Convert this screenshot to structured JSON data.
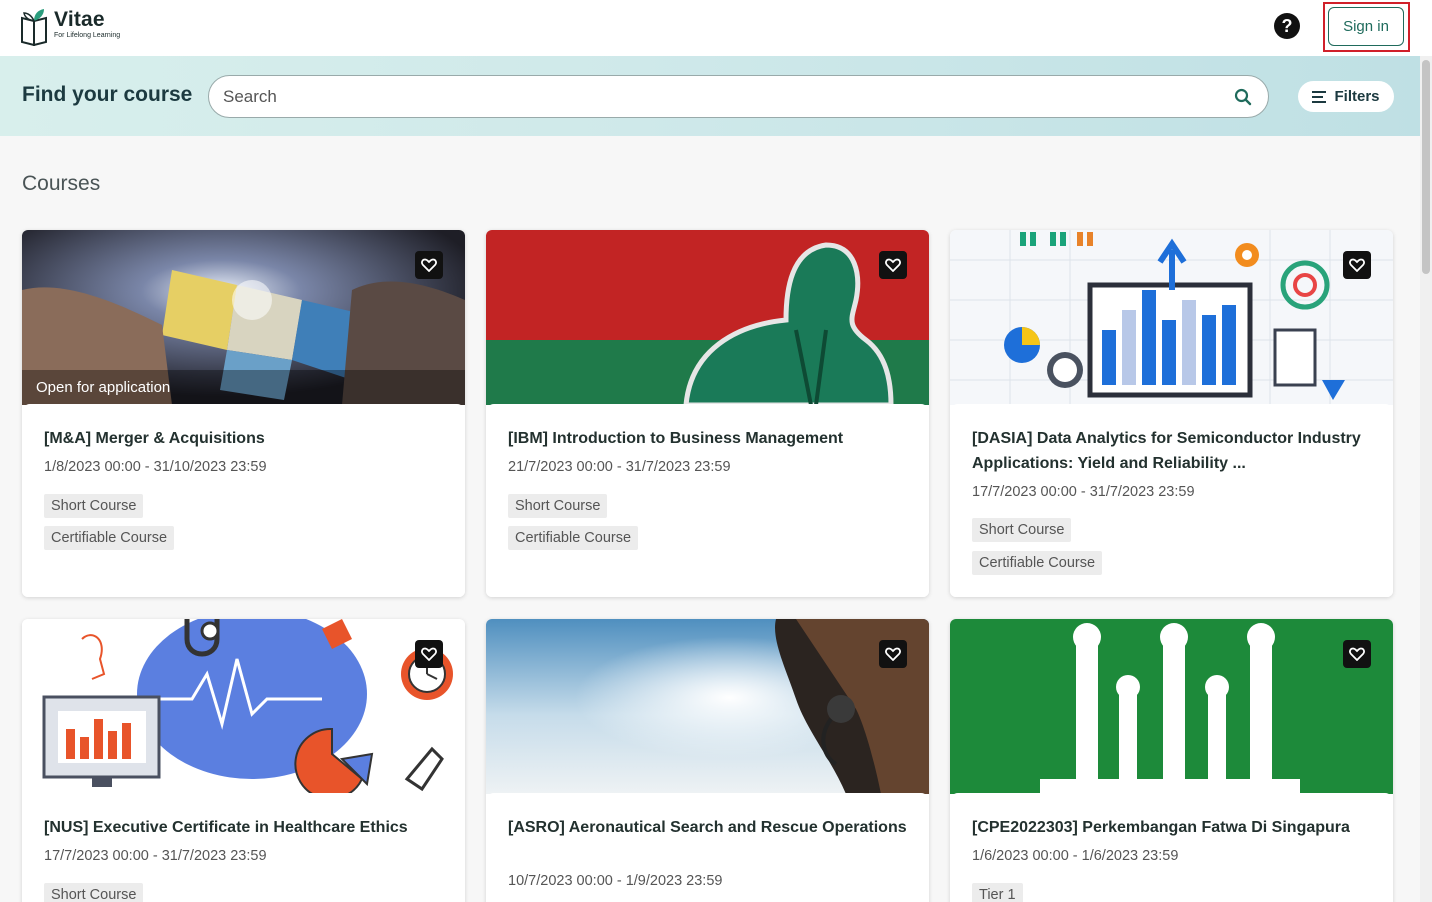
{
  "header": {
    "logo_name": "Vitae",
    "logo_tagline": "For Lifelong Learning",
    "help_label": "?",
    "signin_label": "Sign in"
  },
  "search": {
    "title": "Find your course",
    "placeholder": "Search",
    "filters_label": "Filters"
  },
  "courses": {
    "section_title": "Courses",
    "items": [
      {
        "title": "[M&A] Merger & Acquisitions",
        "dates": "1/8/2023 00:00 - 31/10/2023 23:59",
        "badge": "Open for application",
        "tags": [
          "Short Course",
          "Certifiable Course"
        ]
      },
      {
        "title": "[IBM] Introduction to Business Management",
        "dates": "21/7/2023 00:00 - 31/7/2023 23:59",
        "tags": [
          "Short Course",
          "Certifiable Course"
        ]
      },
      {
        "title": "[DASIA] Data Analytics for Semiconductor Industry Applications: Yield and Reliability ...",
        "dates": "17/7/2023 00:00 - 31/7/2023 23:59",
        "tags": [
          "Short Course",
          "Certifiable Course"
        ]
      },
      {
        "title": "[NUS] Executive Certificate in Healthcare Ethics",
        "dates": "17/7/2023 00:00 - 31/7/2023 23:59",
        "tags": [
          "Short Course"
        ]
      },
      {
        "title": "[ASRO] Aeronautical Search and Rescue Operations",
        "dates": "10/7/2023 00:00 - 1/9/2023 23:59",
        "tags": []
      },
      {
        "title": "[CPE2022303] Perkembangan Fatwa Di Singapura",
        "dates": "1/6/2023 00:00 - 1/6/2023 23:59",
        "tags": [
          "Tier 1"
        ]
      }
    ]
  },
  "colors": {
    "brand_green": "#1f6b5c",
    "highlight_red": "#d0202a"
  }
}
